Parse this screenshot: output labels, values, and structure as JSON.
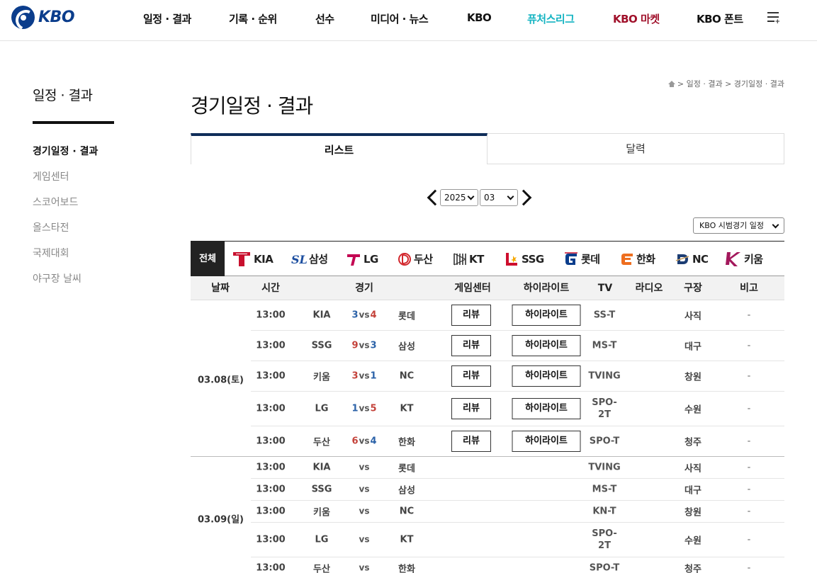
{
  "header": {
    "logo_text": "KBO",
    "menu": [
      "일정 · 결과",
      "기록 · 순위",
      "선수",
      "미디어 · 뉴스",
      "KBO",
      "퓨처스리그",
      "KBO 마켓",
      "KBO 폰트"
    ],
    "allmenu_icon": "all-menu-icon",
    "colors": {
      "futures": "#15b4c2",
      "market": "#a0102a",
      "brand": "#0b3d8c"
    }
  },
  "sidebar": {
    "title": "일정 · 결과",
    "items": [
      {
        "label": "경기일정 · 결과",
        "active": true
      },
      {
        "label": "게임센터",
        "active": false
      },
      {
        "label": "스코어보드",
        "active": false
      },
      {
        "label": "올스타전",
        "active": false
      },
      {
        "label": "국제대회",
        "active": false
      },
      {
        "label": "야구장 날씨",
        "active": false
      }
    ]
  },
  "breadcrumb": {
    "home_icon": "home-icon",
    "text": "> 일정 · 결과 > 경기일정 · 결과"
  },
  "page_title": "경기일정 · 결과",
  "tabs": [
    "리스트",
    "달력"
  ],
  "filters": {
    "year": "2025",
    "month": "03",
    "series": "KBO 시범경기 일정"
  },
  "teams": {
    "all": "전체",
    "list": [
      {
        "name": "KIA",
        "color": "#c8102e"
      },
      {
        "name": "삼성",
        "color": "#1d4fa0"
      },
      {
        "name": "LG",
        "color": "#c30452"
      },
      {
        "name": "두산",
        "color": "#d2282e"
      },
      {
        "name": "KT",
        "color": "#222222"
      },
      {
        "name": "SSG",
        "color": "#ce0e2d"
      },
      {
        "name": "롯데",
        "color": "#0b3d8c"
      },
      {
        "name": "한화",
        "color": "#ee6e1f"
      },
      {
        "name": "NC",
        "color": "#1c3d73"
      },
      {
        "name": "키움",
        "color": "#a3185c"
      }
    ]
  },
  "table": {
    "headers": [
      "날짜",
      "시간",
      "경기",
      "게임센터",
      "하이라이트",
      "TV",
      "라디오",
      "구장",
      "비고"
    ],
    "groups": [
      {
        "date": "03.08(토)",
        "games": [
          {
            "time": "13:00",
            "away": "KIA",
            "away_score": "3",
            "home_score": "4",
            "home": "롯데",
            "center": "리뷰",
            "highlight": "하이라이트",
            "tv": "SS-T",
            "radio": "",
            "stadium": "사직",
            "etc": "-"
          },
          {
            "time": "13:00",
            "away": "SSG",
            "away_score": "9",
            "home_score": "3",
            "home": "삼성",
            "center": "리뷰",
            "highlight": "하이라이트",
            "tv": "MS-T",
            "radio": "",
            "stadium": "대구",
            "etc": "-"
          },
          {
            "time": "13:00",
            "away": "키움",
            "away_score": "3",
            "home_score": "1",
            "home": "NC",
            "center": "리뷰",
            "highlight": "하이라이트",
            "tv": "TVING",
            "radio": "",
            "stadium": "창원",
            "etc": "-"
          },
          {
            "time": "13:00",
            "away": "LG",
            "away_score": "1",
            "home_score": "5",
            "home": "KT",
            "center": "리뷰",
            "highlight": "하이라이트",
            "tv": "SPO-2T",
            "radio": "",
            "stadium": "수원",
            "etc": "-"
          },
          {
            "time": "13:00",
            "away": "두산",
            "away_score": "6",
            "home_score": "4",
            "home": "한화",
            "center": "리뷰",
            "highlight": "하이라이트",
            "tv": "SPO-T",
            "radio": "",
            "stadium": "청주",
            "etc": "-"
          }
        ]
      },
      {
        "date": "03.09(일)",
        "games": [
          {
            "time": "13:00",
            "away": "KIA",
            "away_score": "",
            "home_score": "",
            "home": "롯데",
            "center": "",
            "highlight": "",
            "tv": "TVING",
            "radio": "",
            "stadium": "사직",
            "etc": "-"
          },
          {
            "time": "13:00",
            "away": "SSG",
            "away_score": "",
            "home_score": "",
            "home": "삼성",
            "center": "",
            "highlight": "",
            "tv": "MS-T",
            "radio": "",
            "stadium": "대구",
            "etc": "-"
          },
          {
            "time": "13:00",
            "away": "키움",
            "away_score": "",
            "home_score": "",
            "home": "NC",
            "center": "",
            "highlight": "",
            "tv": "KN-T",
            "radio": "",
            "stadium": "창원",
            "etc": "-"
          },
          {
            "time": "13:00",
            "away": "LG",
            "away_score": "",
            "home_score": "",
            "home": "KT",
            "center": "",
            "highlight": "",
            "tv": "SPO-2T",
            "radio": "",
            "stadium": "수원",
            "etc": "-"
          },
          {
            "time": "13:00",
            "away": "두산",
            "away_score": "",
            "home_score": "",
            "home": "한화",
            "center": "",
            "highlight": "",
            "tv": "SPO-T",
            "radio": "",
            "stadium": "청주",
            "etc": "-"
          }
        ]
      }
    ],
    "vs_text": "vs"
  }
}
